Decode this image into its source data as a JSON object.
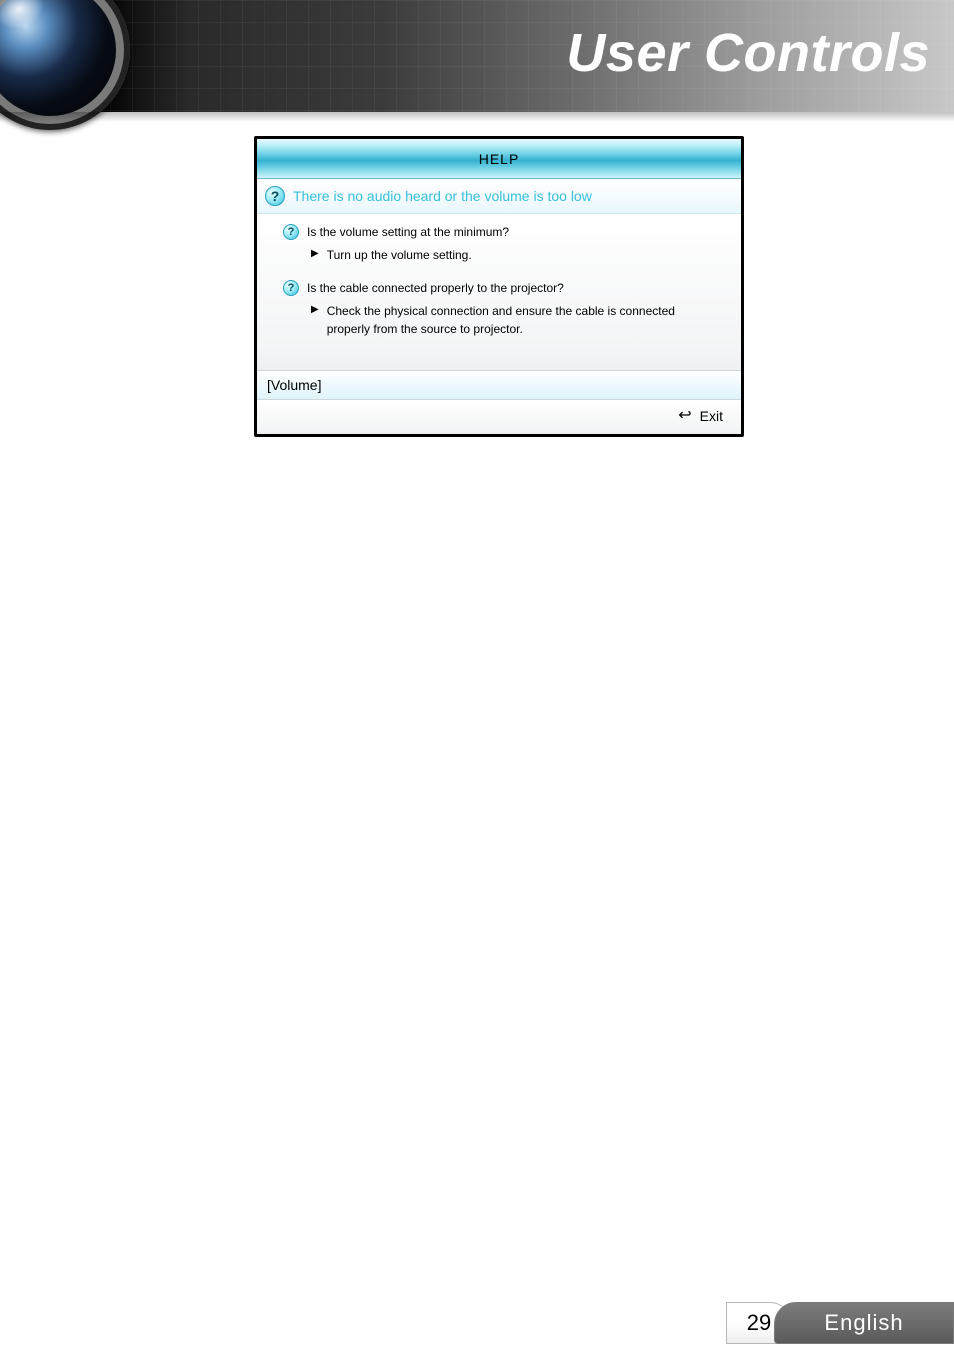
{
  "header": {
    "title": "User Controls"
  },
  "panel": {
    "title": "HELP",
    "topic": "There is no audio heard or the volume is too low",
    "items": [
      {
        "question": "Is the volume setting at the minimum?",
        "action": "Turn up the volume setting."
      },
      {
        "question": "Is the cable connected properly to the projector?",
        "action": "Check the physical connection and ensure the cable is connected properly from the source to projector."
      }
    ],
    "selected": "[Volume]",
    "exit_label": "Exit"
  },
  "footer": {
    "page": "29",
    "language": "English"
  }
}
